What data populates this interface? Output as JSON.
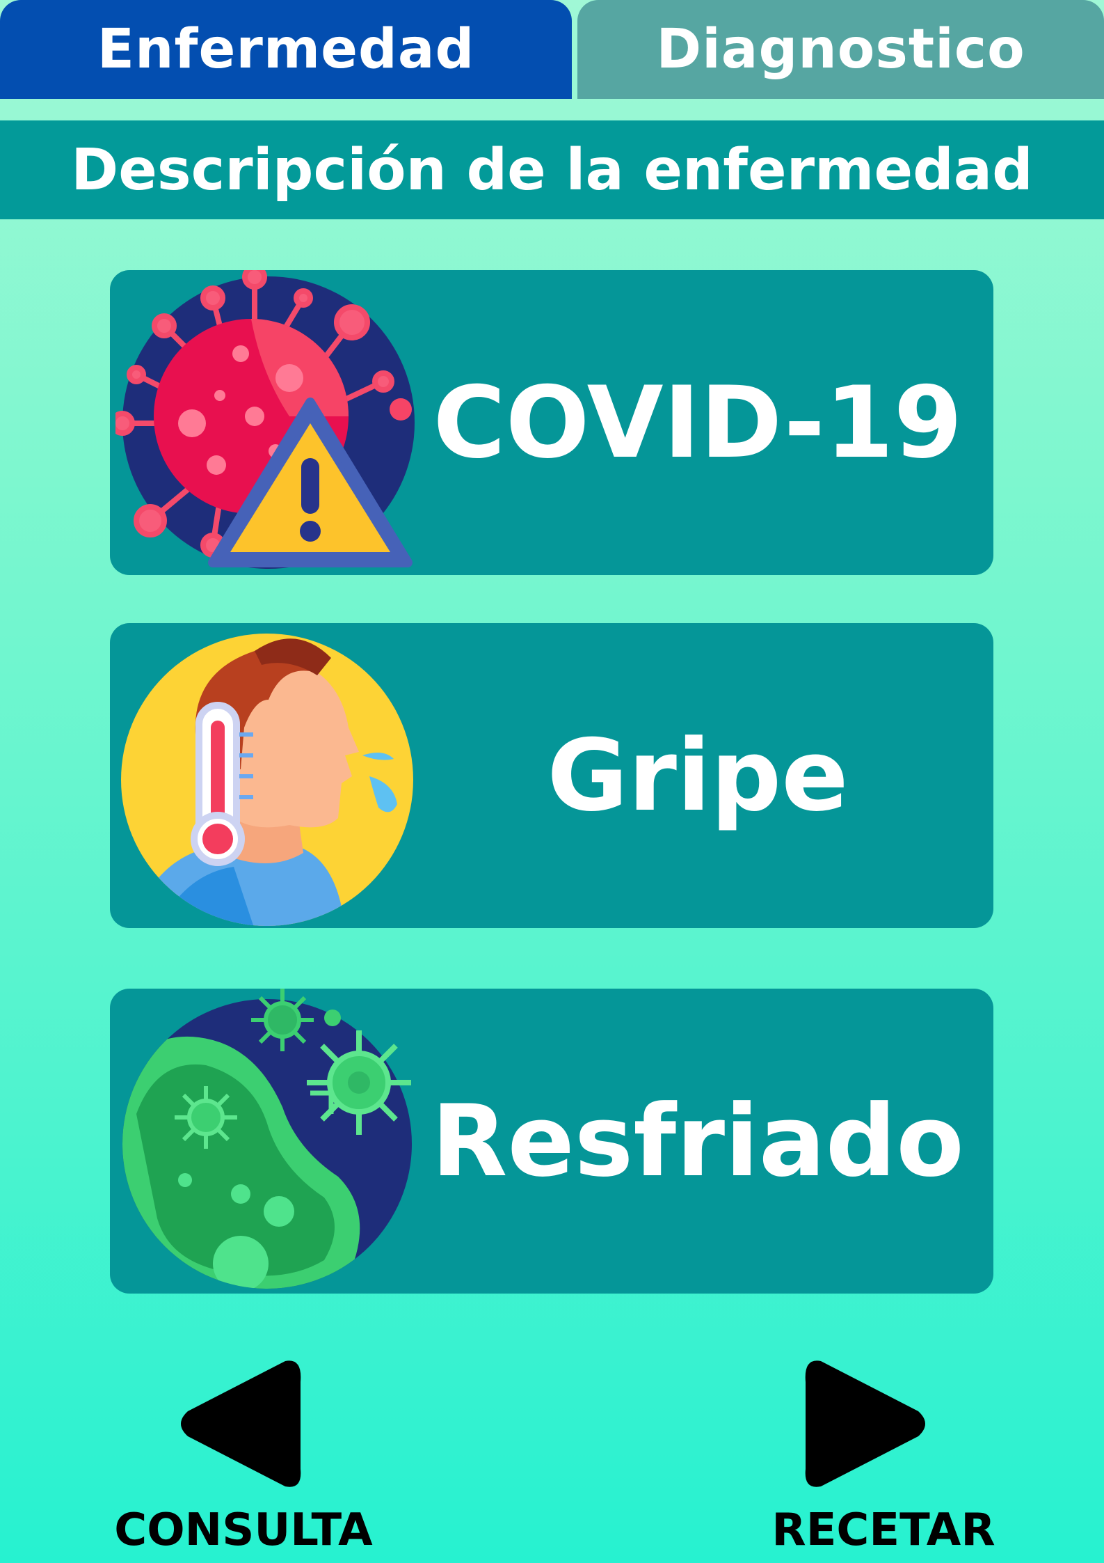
{
  "tabs": {
    "enfermedad": "Enfermedad",
    "diagnostico": "Diagnostico"
  },
  "header": {
    "title": "Descripción de la enfermedad"
  },
  "diseases": [
    {
      "label": "COVID-19",
      "icon": "virus-warning-icon"
    },
    {
      "label": "Gripe",
      "icon": "fever-thermometer-icon"
    },
    {
      "label": "Resfriado",
      "icon": "germs-icon"
    }
  ],
  "navigation": {
    "back_label": "CONSULTA",
    "back_icon": "back-arrow-icon",
    "next_label": "RECETAR",
    "next_icon": "next-arrow-icon"
  },
  "colors": {
    "active_tab": "#034eb0",
    "inactive_tab": "#56a6a2",
    "band": "#039a99",
    "card": "#059698",
    "text": "#ffffff",
    "nav": "#000000"
  }
}
